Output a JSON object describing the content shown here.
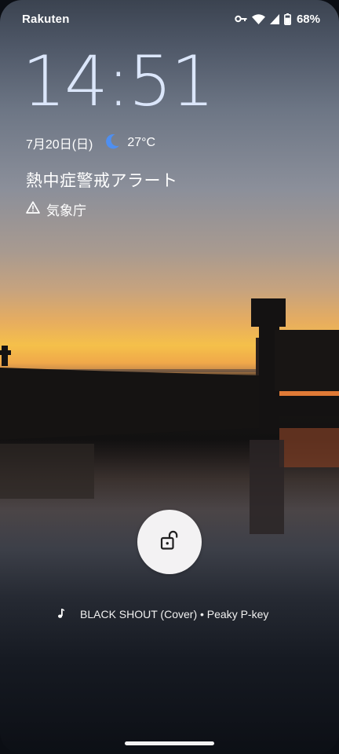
{
  "status_bar": {
    "carrier": "Rakuten",
    "battery_percent": "68%",
    "icons": [
      "vpn-key-icon",
      "wifi-icon",
      "cellular-signal-icon",
      "battery-icon"
    ]
  },
  "lock_screen": {
    "time": "14:51",
    "date": "7月20日(日)",
    "weather_icon": "moon-icon",
    "temperature": "27°C",
    "alert": {
      "title": "熱中症警戒アラート",
      "icon": "warning-icon",
      "source": "気象庁"
    },
    "unlock_icon": "unlock-icon",
    "now_playing": {
      "icon": "music-note-icon",
      "text": "BLACK SHOUT (Cover) • Peaky P-key"
    }
  },
  "colors": {
    "clock": "#dbe6fa",
    "moon": "#4f8ff0",
    "unlock_button_bg": "#f3f2f3"
  }
}
